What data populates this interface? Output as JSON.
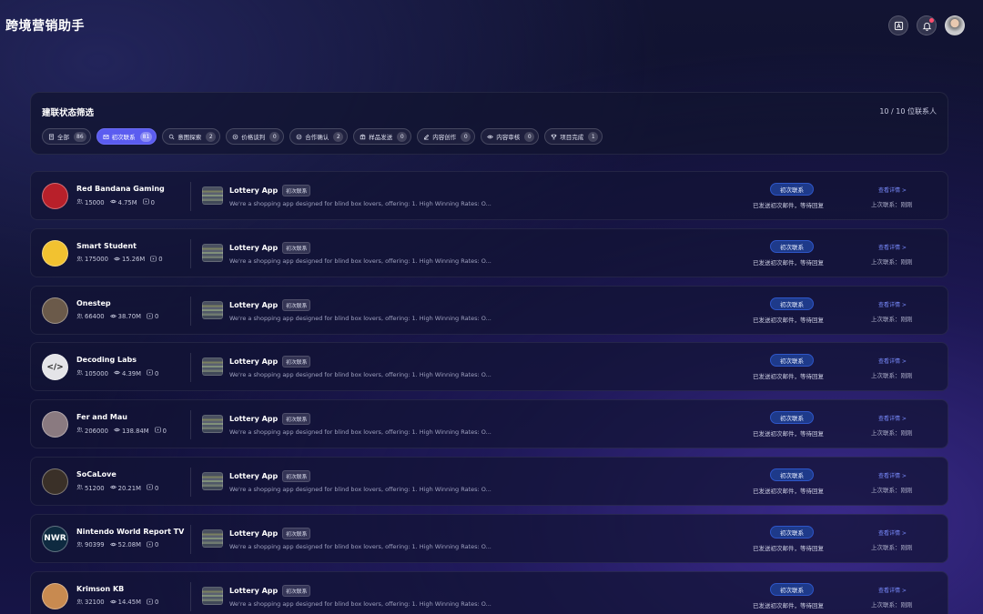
{
  "app": {
    "title": "跨境营销助手"
  },
  "filter": {
    "title": "建联状态筛选",
    "count_text": "10 / 10 位联系人",
    "chips": [
      {
        "label": "全部",
        "count": "86",
        "icon": "list-icon"
      },
      {
        "label": "初次联系",
        "count": "81",
        "icon": "mail-icon",
        "active": true
      },
      {
        "label": "意图探索",
        "count": "2",
        "icon": "search-icon"
      },
      {
        "label": "价格谈判",
        "count": "0",
        "icon": "coin-icon"
      },
      {
        "label": "合作确认",
        "count": "2",
        "icon": "check-circle-icon"
      },
      {
        "label": "样品发送",
        "count": "0",
        "icon": "package-icon"
      },
      {
        "label": "内容创作",
        "count": "0",
        "icon": "pen-icon"
      },
      {
        "label": "内容审核",
        "count": "0",
        "icon": "eye-icon"
      },
      {
        "label": "项目完成",
        "count": "1",
        "icon": "trophy-icon"
      }
    ]
  },
  "contacts": [
    {
      "name": "Red Bandana Gaming",
      "followers": "15000",
      "views": "4.75M",
      "videos": "0",
      "avatar_color": "#b8202a",
      "avatar_text": ""
    },
    {
      "name": "Smart Student",
      "followers": "175000",
      "views": "15.26M",
      "videos": "0",
      "avatar_color": "#f2c230",
      "avatar_text": ""
    },
    {
      "name": "Onestep",
      "followers": "66400",
      "views": "38.70M",
      "videos": "0",
      "avatar_color": "#6b5a4a",
      "avatar_text": ""
    },
    {
      "name": "Decoding Labs",
      "followers": "105000",
      "views": "4.39M",
      "videos": "0",
      "avatar_color": "#e4e4e8",
      "avatar_text": "</>"
    },
    {
      "name": "Fer and Mau",
      "followers": "206000",
      "views": "138.84M",
      "videos": "0",
      "avatar_color": "#8a7a80",
      "avatar_text": ""
    },
    {
      "name": "SoCaLove",
      "followers": "51200",
      "views": "20.21M",
      "videos": "0",
      "avatar_color": "#3a3028",
      "avatar_text": ""
    },
    {
      "name": "Nintendo World Report TV",
      "followers": "90399",
      "views": "52.08M",
      "videos": "0",
      "avatar_color": "#0e2a40",
      "avatar_text": "NWR"
    },
    {
      "name": "Krimson KB",
      "followers": "32100",
      "views": "14.45M",
      "videos": "0",
      "avatar_color": "#c88a50",
      "avatar_text": ""
    }
  ],
  "row_common": {
    "campaign": "Lottery App",
    "campaign_tag": "初次联系",
    "description": "We're a shopping app designed for blind box lovers, offering: 1. High Winning Rates: O...",
    "status": "初次联系",
    "status_text": "已发送初次邮件，等待回复",
    "detail_link": "查看详情 >",
    "last_contact": "上次联系：刚刚"
  },
  "colors": {
    "accent": "#5b5cf0",
    "status_badge": "#1e3a8a",
    "link": "#7a8cff"
  }
}
